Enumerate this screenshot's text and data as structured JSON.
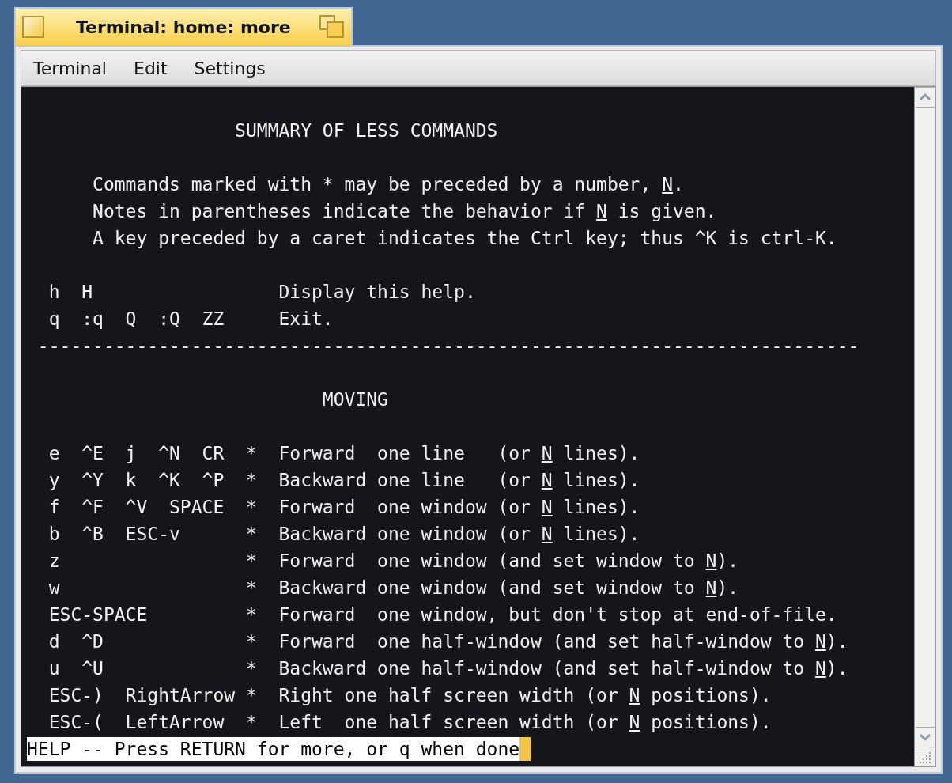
{
  "window": {
    "title": "Terminal: home: more"
  },
  "menu": [
    "Terminal",
    "Edit",
    "Settings"
  ],
  "terminal": {
    "lines": [
      {
        "kind": "blank"
      },
      {
        "kind": "text",
        "segments": [
          {
            "text": "                   SUMMARY OF LESS COMMANDS",
            "underlined": false
          }
        ]
      },
      {
        "kind": "blank"
      },
      {
        "kind": "text",
        "segments": [
          {
            "text": "      Commands marked with * may be preceded by a number, ",
            "underlined": false
          },
          {
            "text": "N",
            "underlined": true
          },
          {
            "text": ".",
            "underlined": false
          }
        ]
      },
      {
        "kind": "text",
        "segments": [
          {
            "text": "      Notes in parentheses indicate the behavior if ",
            "underlined": false
          },
          {
            "text": "N",
            "underlined": true
          },
          {
            "text": " is given.",
            "underlined": false
          }
        ]
      },
      {
        "kind": "text",
        "segments": [
          {
            "text": "      A key preceded by a caret indicates the Ctrl key; thus ^K is ctrl-K.",
            "underlined": false
          }
        ]
      },
      {
        "kind": "blank"
      },
      {
        "kind": "text",
        "segments": [
          {
            "text": "  h  H                 Display this help.",
            "underlined": false
          }
        ]
      },
      {
        "kind": "text",
        "segments": [
          {
            "text": "  q  :q  Q  :Q  ZZ     Exit.",
            "underlined": false
          }
        ]
      },
      {
        "kind": "text",
        "segments": [
          {
            "text": " ---------------------------------------------------------------------------",
            "underlined": false
          }
        ]
      },
      {
        "kind": "blank"
      },
      {
        "kind": "text",
        "segments": [
          {
            "text": "                           MOVING",
            "underlined": false
          }
        ]
      },
      {
        "kind": "blank"
      },
      {
        "kind": "text",
        "segments": [
          {
            "text": "  e  ^E  j  ^N  CR  *  Forward  one line   (or ",
            "underlined": false
          },
          {
            "text": "N",
            "underlined": true
          },
          {
            "text": " lines).",
            "underlined": false
          }
        ]
      },
      {
        "kind": "text",
        "segments": [
          {
            "text": "  y  ^Y  k  ^K  ^P  *  Backward one line   (or ",
            "underlined": false
          },
          {
            "text": "N",
            "underlined": true
          },
          {
            "text": " lines).",
            "underlined": false
          }
        ]
      },
      {
        "kind": "text",
        "segments": [
          {
            "text": "  f  ^F  ^V  SPACE  *  Forward  one window (or ",
            "underlined": false
          },
          {
            "text": "N",
            "underlined": true
          },
          {
            "text": " lines).",
            "underlined": false
          }
        ]
      },
      {
        "kind": "text",
        "segments": [
          {
            "text": "  b  ^B  ESC-v      *  Backward one window (or ",
            "underlined": false
          },
          {
            "text": "N",
            "underlined": true
          },
          {
            "text": " lines).",
            "underlined": false
          }
        ]
      },
      {
        "kind": "text",
        "segments": [
          {
            "text": "  z                 *  Forward  one window (and set window to ",
            "underlined": false
          },
          {
            "text": "N",
            "underlined": true
          },
          {
            "text": ").",
            "underlined": false
          }
        ]
      },
      {
        "kind": "text",
        "segments": [
          {
            "text": "  w                 *  Backward one window (and set window to ",
            "underlined": false
          },
          {
            "text": "N",
            "underlined": true
          },
          {
            "text": ").",
            "underlined": false
          }
        ]
      },
      {
        "kind": "text",
        "segments": [
          {
            "text": "  ESC-SPACE         *  Forward  one window, but don't stop at end-of-file.",
            "underlined": false
          }
        ]
      },
      {
        "kind": "text",
        "segments": [
          {
            "text": "  d  ^D             *  Forward  one half-window (and set half-window to ",
            "underlined": false
          },
          {
            "text": "N",
            "underlined": true
          },
          {
            "text": ").",
            "underlined": false
          }
        ]
      },
      {
        "kind": "text",
        "segments": [
          {
            "text": "  u  ^U             *  Backward one half-window (and set half-window to ",
            "underlined": false
          },
          {
            "text": "N",
            "underlined": true
          },
          {
            "text": ").",
            "underlined": false
          }
        ]
      },
      {
        "kind": "text",
        "segments": [
          {
            "text": "  ESC-)  RightArrow *  Right one half screen width (or ",
            "underlined": false
          },
          {
            "text": "N",
            "underlined": true
          },
          {
            "text": " positions).",
            "underlined": false
          }
        ]
      },
      {
        "kind": "text",
        "segments": [
          {
            "text": "  ESC-(  LeftArrow  *  Left  one half screen width (or ",
            "underlined": false
          },
          {
            "text": "N",
            "underlined": true
          },
          {
            "text": " positions).",
            "underlined": false
          }
        ]
      }
    ],
    "prompt": "HELP -- Press RETURN for more, or q when done"
  }
}
